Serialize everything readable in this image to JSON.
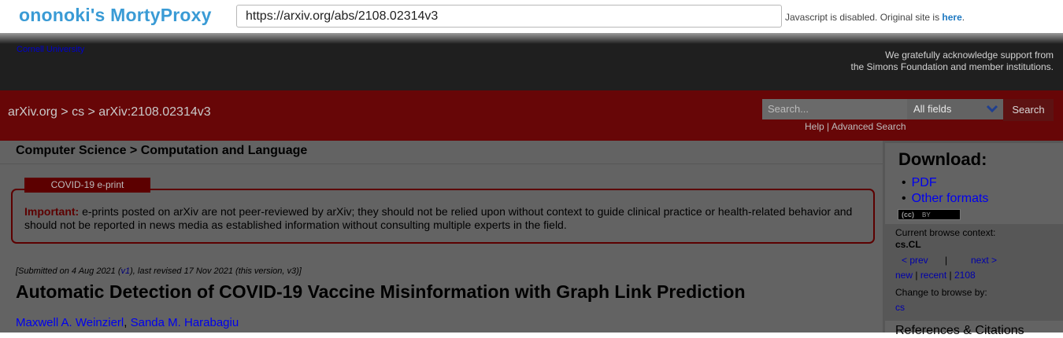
{
  "proxy": {
    "title": "ononoki's MortyProxy",
    "url": "https://arxiv.org/abs/2108.02314v3",
    "note_text": "Javascript is disabled. Original site is ",
    "note_link": "here",
    "note_end": "."
  },
  "header": {
    "cornell": "Cornell University",
    "support_line1": "We gratefully acknowledge support from",
    "support_line2": "the Simons Foundation and member institutions."
  },
  "nav": {
    "breadcrumb": "arXiv.org > cs > arXiv:2108.02314v3",
    "search_placeholder": "Search...",
    "field_selected": "All fields",
    "search_button": "Search",
    "help_link": "Help",
    "help_sep": " | ",
    "advanced_link": "Advanced Search"
  },
  "main": {
    "subject": "Computer Science > Computation and Language",
    "covid_tab": "COVID-19 e-print",
    "important_label": "Important:",
    "covid_message": " e-prints posted on arXiv are not peer-reviewed by arXiv; they should not be relied upon without context to guide clinical practice or health-related behavior and should not be reported in news media as established information without consulting multiple experts in the field.",
    "dateline_pre": "[Submitted on 4 Aug 2021 (",
    "dateline_v1": "v1",
    "dateline_post": "), last revised 17 Nov 2021 (this version, v3)]",
    "title": "Automatic Detection of COVID-19 Vaccine Misinformation with Graph Link Prediction",
    "authors": [
      "Maxwell A. Weinzierl",
      "Sanda M. Harabagiu"
    ],
    "author_sep": ", "
  },
  "sidebar": {
    "download_head": "Download:",
    "downloads": [
      "PDF",
      "Other formats"
    ],
    "license_cc": "(cc)",
    "license_by": "BY",
    "browse_label": "Current browse context:",
    "browse_context": "cs.CL",
    "prev": "< prev",
    "pipe": "|",
    "next": "next >",
    "new": "new",
    "recent": "recent",
    "archive": "2108",
    "change_label": "Change to browse by:",
    "change_cs": "cs",
    "refs_head": "References & Citations"
  },
  "colors": {
    "proxy_title": "#3a9bd5",
    "dark_header": "#1f1f1f",
    "red_bar": "#670607",
    "covid_accent": "#5c0000"
  }
}
